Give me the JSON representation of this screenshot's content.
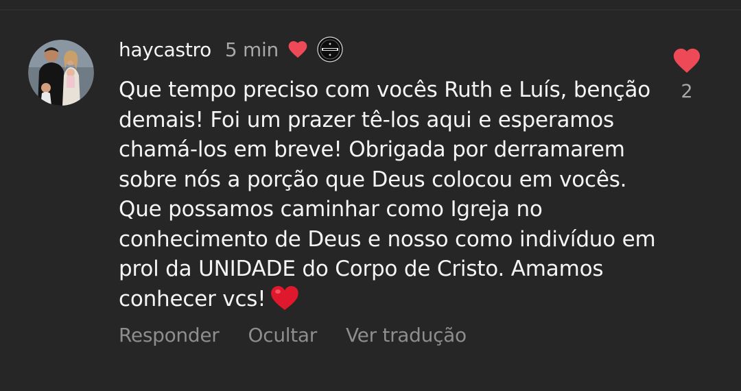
{
  "comment": {
    "username": "haycastro",
    "timestamp": "5 min",
    "text": "Que tempo preciso com vocês Ruth e Luís, benção demais! Foi um prazer tê-los aqui e esperamos chamá-los em breve! Obrigada por derramarem sobre nós a porção que Deus colocou em vocês. Que possamos caminhar como Igreja no conhecimento de Deus e nosso como indivíduo em prol da UNIDADE do Corpo de Cristo. Amamos conhecer vcs!",
    "trailing_emoji": "heart-emoji",
    "author_liked_icon": "heart-icon",
    "badge_icon": "circular-logo-badge-icon",
    "avatar_icon": "profile-photo-avatar"
  },
  "actions": {
    "reply": "Responder",
    "hide": "Ocultar",
    "translate": "Ver tradução"
  },
  "likes": {
    "count": "2",
    "icon": "heart-icon",
    "liked": true
  },
  "colors": {
    "background": "#262626",
    "text_primary": "#f5f5f5",
    "text_secondary": "#a8a8a8",
    "action_text": "#8e8e8e",
    "heart": "#ed4956"
  }
}
